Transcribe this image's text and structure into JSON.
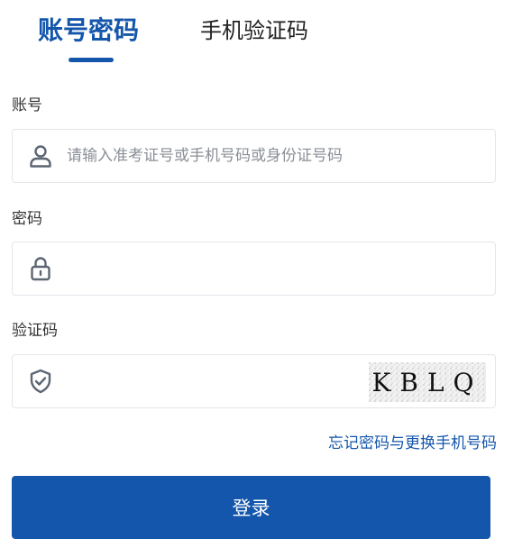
{
  "tabs": [
    {
      "label": "账号密码",
      "active": true
    },
    {
      "label": "手机验证码",
      "active": false
    }
  ],
  "form": {
    "account": {
      "label": "账号",
      "placeholder": "请输入准考证号或手机号码或身份证号码",
      "value": "",
      "icon": "user-icon"
    },
    "password": {
      "label": "密码",
      "placeholder": "",
      "value": "",
      "icon": "lock-icon"
    },
    "captcha": {
      "label": "验证码",
      "placeholder": "",
      "value": "",
      "icon": "shield-check-icon",
      "image_text": "KBLQ"
    }
  },
  "forgot_link": "忘记密码与更换手机号码",
  "login_button": "登录",
  "colors": {
    "primary": "#1456ab",
    "border": "#e3e6ea",
    "icon": "#5d6673"
  }
}
